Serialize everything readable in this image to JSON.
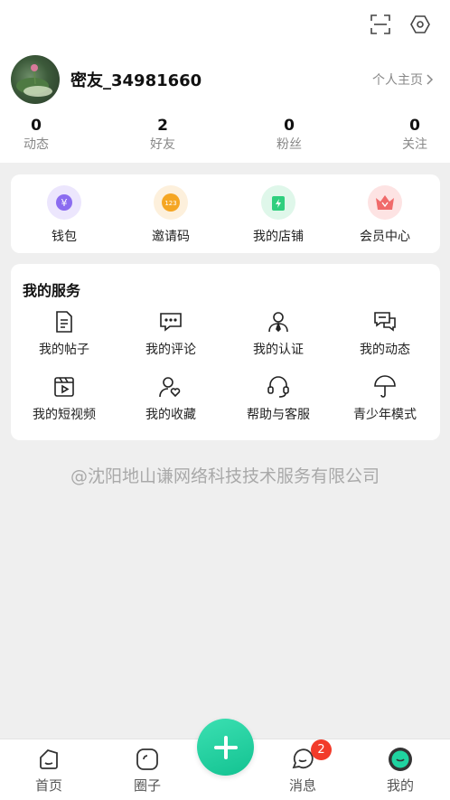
{
  "header": {
    "scan_icon": "scan-icon",
    "settings_icon": "settings-icon"
  },
  "profile": {
    "username": "密友_34981660",
    "homepage_link": "个人主页"
  },
  "stats": [
    {
      "value": "0",
      "label": "动态"
    },
    {
      "value": "2",
      "label": "好友"
    },
    {
      "value": "0",
      "label": "粉丝"
    },
    {
      "value": "0",
      "label": "关注"
    }
  ],
  "quick_actions": [
    {
      "label": "钱包",
      "icon": "wallet-icon",
      "color": "#8b6cf0",
      "bg": "#ece6fd"
    },
    {
      "label": "邀请码",
      "icon": "invite-code-icon",
      "color": "#f5a623",
      "bg": "#fdf0dc"
    },
    {
      "label": "我的店铺",
      "icon": "shop-icon",
      "color": "#2fcf7e",
      "bg": "#dff7ea"
    },
    {
      "label": "会员中心",
      "icon": "vip-crown-icon",
      "color": "#f06a6a",
      "bg": "#fde3e3"
    }
  ],
  "services": {
    "title": "我的服务",
    "items": [
      {
        "label": "我的帖子",
        "icon": "document-icon"
      },
      {
        "label": "我的评论",
        "icon": "comment-icon"
      },
      {
        "label": "我的认证",
        "icon": "verified-user-icon"
      },
      {
        "label": "我的动态",
        "icon": "moments-icon"
      },
      {
        "label": "我的短视频",
        "icon": "video-icon"
      },
      {
        "label": "我的收藏",
        "icon": "favorite-user-icon"
      },
      {
        "label": "帮助与客服",
        "icon": "headset-icon"
      },
      {
        "label": "青少年模式",
        "icon": "umbrella-icon"
      }
    ]
  },
  "company": "@沈阳地山谦网络科技技术服务有限公司",
  "tabbar": {
    "tabs": [
      {
        "label": "首页",
        "icon": "home-icon"
      },
      {
        "label": "圈子",
        "icon": "circle-icon"
      },
      {
        "label": "消息",
        "icon": "message-icon",
        "badge": "2"
      },
      {
        "label": "我的",
        "icon": "profile-icon"
      }
    ],
    "fab_icon": "plus-icon",
    "accent": "#1fd3a0"
  }
}
